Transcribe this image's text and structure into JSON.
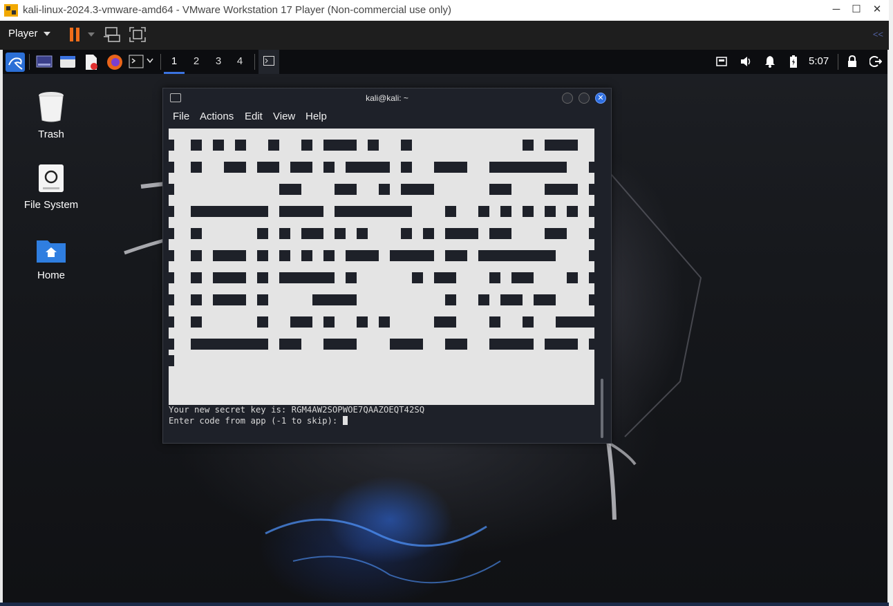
{
  "vm": {
    "title": "kali-linux-2024.3-vmware-amd64 - VMware Workstation 17 Player (Non-commercial use only)",
    "player_menu": "Player",
    "minimize": "─",
    "maximize": "☐",
    "close": "✕",
    "collapse": "<<"
  },
  "panel": {
    "workspaces": [
      "1",
      "2",
      "3",
      "4"
    ],
    "active_workspace": "1",
    "clock": "5:07"
  },
  "desktop": {
    "icons": [
      {
        "label": "Trash",
        "icon": "trash-icon"
      },
      {
        "label": "File System",
        "icon": "drive-icon"
      },
      {
        "label": "Home",
        "icon": "home-folder-icon"
      }
    ]
  },
  "terminal": {
    "title": "kali@kali: ~",
    "close_glyph": "✕",
    "menu": [
      "File",
      "Actions",
      "Edit",
      "View",
      "Help"
    ],
    "lines": [
      "Your new secret key is: RGM4AW2SOPWOE7QAAZOEQT42SQ",
      "Enter code from app (-1 to skip): "
    ]
  },
  "colors": {
    "accent": "#3b73e0",
    "pause": "#f06d1a",
    "terminal_bg": "#1e2129",
    "qr_light": "#e4e4e4",
    "qr_dark": "#1e2129"
  }
}
